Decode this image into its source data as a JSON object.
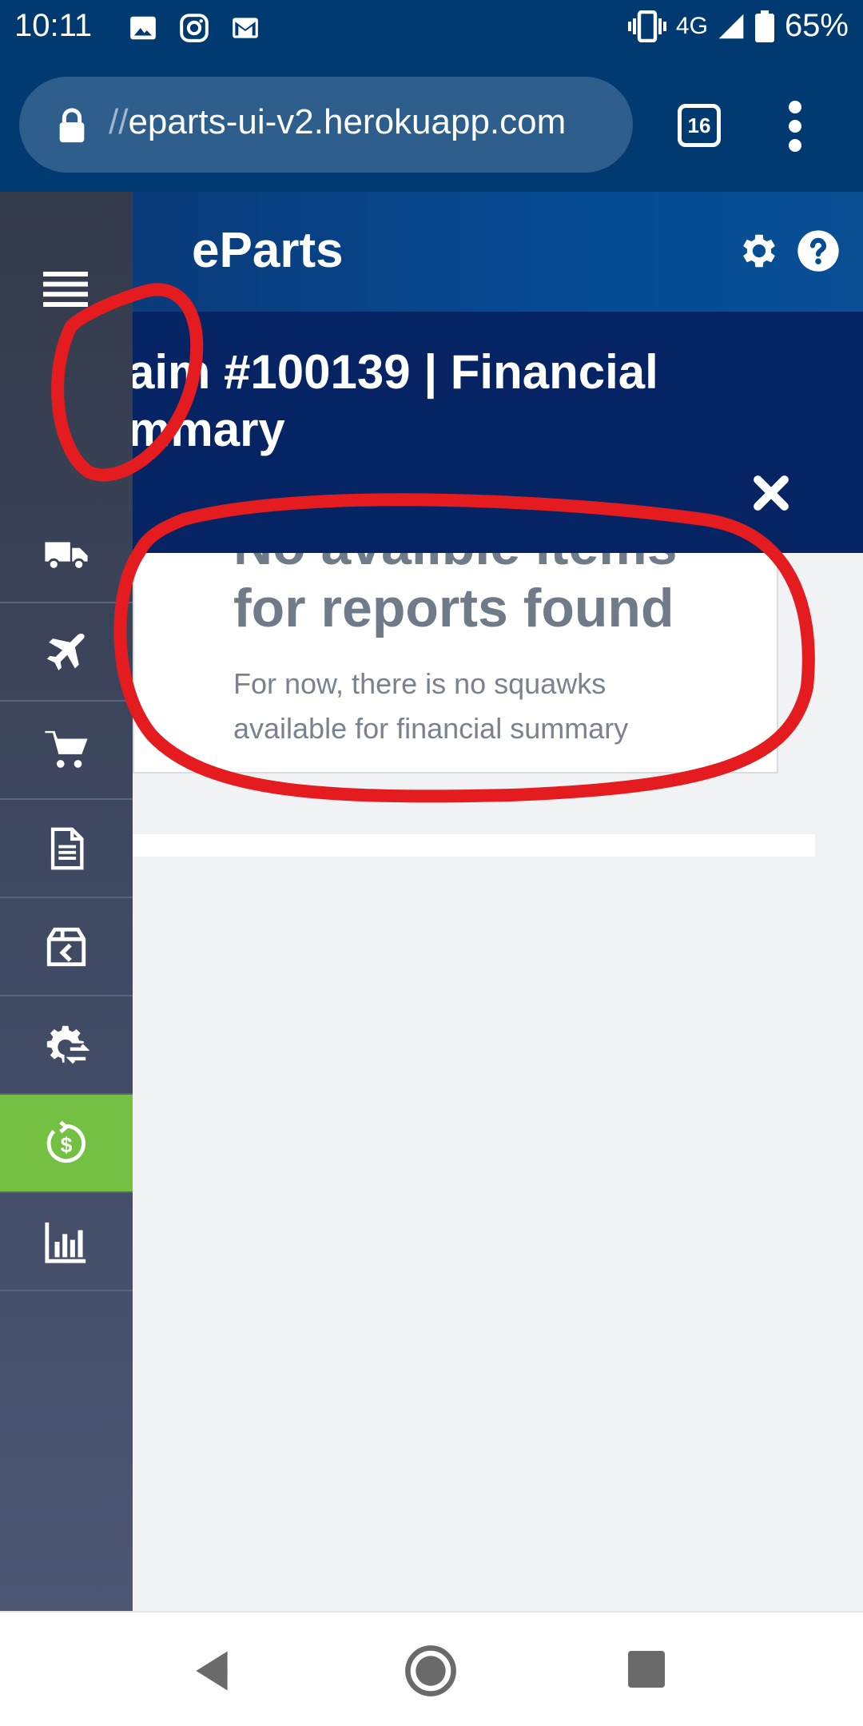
{
  "status_bar": {
    "time": "10:11",
    "network": "4G",
    "battery": "65%",
    "icons": [
      "image-icon",
      "instagram-icon",
      "gmail-icon",
      "vibrate-icon",
      "signal-icon",
      "battery-icon"
    ]
  },
  "browser": {
    "url_prefix": "//",
    "url": "eparts-ui-v2.herokuapp.com",
    "tab_count": "16"
  },
  "app": {
    "title": "eParts"
  },
  "page": {
    "title_line1": "aim #100139 | Financial",
    "title_line2": "mmary"
  },
  "empty_state": {
    "heading_cut": "No availble items",
    "heading": "for reports found",
    "description": "For now, there is no squawks available for financial summary"
  },
  "sidebar": {
    "items": [
      {
        "icon": "truck-icon",
        "active": false
      },
      {
        "icon": "airplane-icon",
        "active": false
      },
      {
        "icon": "cart-icon",
        "active": false
      },
      {
        "icon": "document-icon",
        "active": false
      },
      {
        "icon": "box-return-icon",
        "active": false
      },
      {
        "icon": "gear-exchange-icon",
        "active": false
      },
      {
        "icon": "dollar-refresh-icon",
        "active": true
      },
      {
        "icon": "bar-chart-icon",
        "active": false
      }
    ]
  },
  "colors": {
    "status_bar": "#013a70",
    "header": "#054c95",
    "title_band": "#062463",
    "sidebar": "#3f4962",
    "active_item": "#74c043",
    "annotation": "#e41c1f"
  }
}
